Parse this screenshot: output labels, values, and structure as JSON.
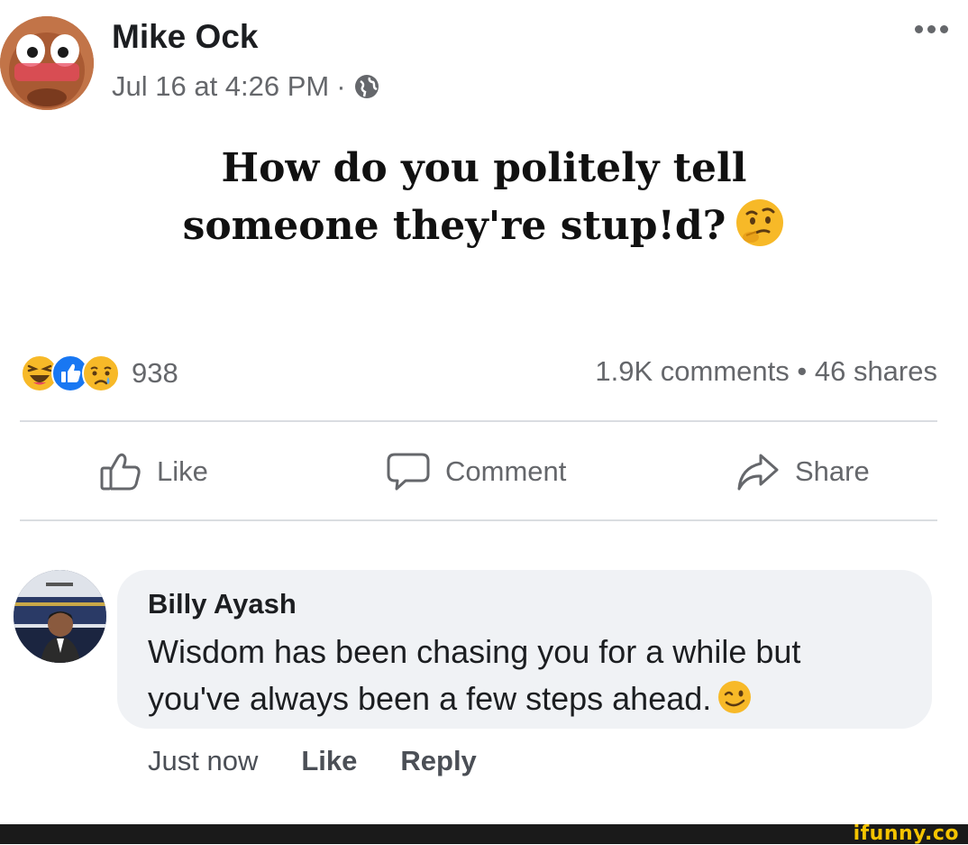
{
  "post": {
    "author": "Mike Ock",
    "date": "Jul 16 at 4:26 PM",
    "separator": "·",
    "privacy_icon": "globe-icon",
    "more_icon": "more-options-icon",
    "text_line1": "How do you politely tell",
    "text_line2": "someone they're stup!d?",
    "emoji": "thinking-face"
  },
  "reactions": {
    "icons": [
      "haha",
      "like",
      "sad"
    ],
    "count": "938"
  },
  "engagement": "1.9K comments • 46 shares",
  "actions": {
    "like": "Like",
    "comment": "Comment",
    "share": "Share"
  },
  "comment": {
    "author": "Billy Ayash",
    "text": "Wisdom has been chasing you for a while but you've always been a few steps ahead.",
    "emoji": "winking-face",
    "time": "Just now",
    "like": "Like",
    "reply": "Reply"
  },
  "watermark": "ifunny.co",
  "colors": {
    "text": "#1c1e21",
    "secondary": "#65676b",
    "like_blue": "#1877f2",
    "reaction_yellow": "#f7b928",
    "bubble": "#f0f2f5",
    "watermark": "#f5c400"
  }
}
